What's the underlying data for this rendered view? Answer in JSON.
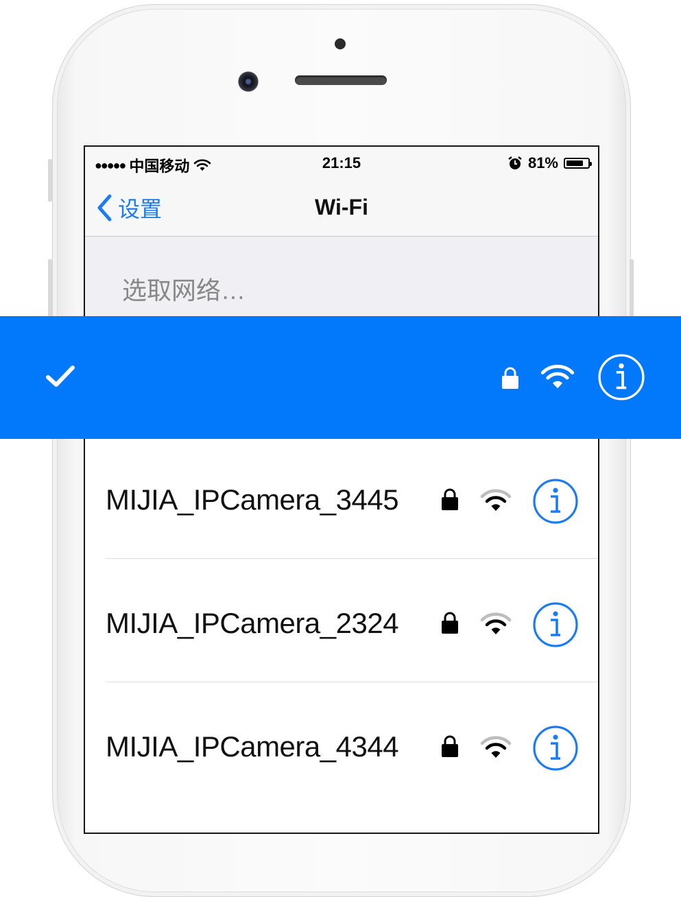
{
  "status_bar": {
    "carrier": "中国移动",
    "time": "21:15",
    "battery_percent_label": "81%",
    "battery_level": 0.81,
    "signal_icon": "signal-dots-icon",
    "wifi_icon": "wifi-icon",
    "alarm_icon": "alarm-icon"
  },
  "nav": {
    "back_label": "设置",
    "title": "Wi-Fi"
  },
  "section": {
    "header": "选取网络…"
  },
  "selected_network": {
    "name": "",
    "checked": true,
    "color": "#0278fb"
  },
  "networks": [
    {
      "name": "MIJIA_IPCamera_3445"
    },
    {
      "name": "MIJIA_IPCamera_2324"
    },
    {
      "name": "MIJIA_IPCamera_4344"
    }
  ],
  "colors": {
    "accent": "#1a7cf4",
    "banner": "#0278fb"
  }
}
